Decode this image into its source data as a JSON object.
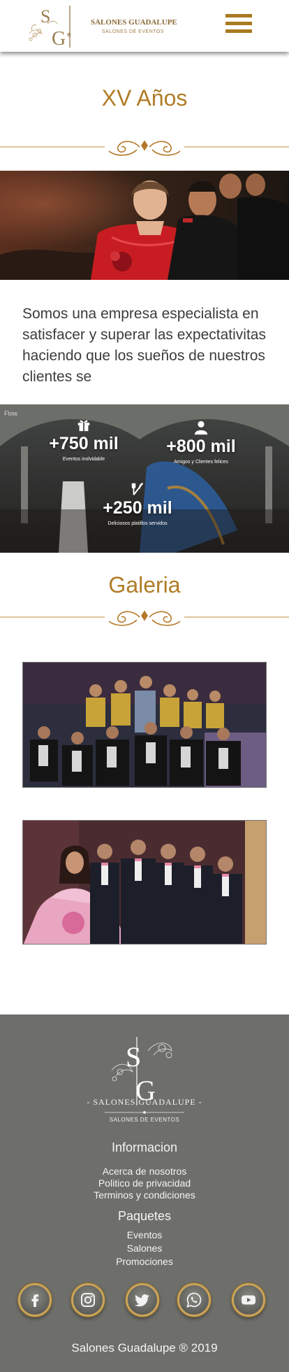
{
  "header": {
    "brand_name": "SALONES GUADALUPE",
    "brand_sub": "SALONES DE EVENTOS",
    "menu_icon": "hamburger-menu-icon"
  },
  "page": {
    "title": "XV Años",
    "intro": "Somos una empresa especialista en satisfacer y superar las expectativitas haciendo que los sueños de nuestros clientes se"
  },
  "stats": [
    {
      "icon": "gift-icon",
      "value": "+750 mil",
      "label": "Eventos inolvidable"
    },
    {
      "icon": "person-icon",
      "value": "+800 mil",
      "label": "Amigos y Clientes felices"
    },
    {
      "icon": "cutlery-icon",
      "value": "+250 mil",
      "label": "Deliciosos platillos servidos"
    }
  ],
  "gallery": {
    "title": "Galeria"
  },
  "footer": {
    "brand_name": "- SALONES GUADALUPE -",
    "brand_sub": "SALONES DE EVENTOS",
    "info_heading": "Informacion",
    "info_links": [
      "Acerca de nosotros",
      "Politico de privacidad",
      "Terminos y condiciones"
    ],
    "packages_heading": "Paquetes",
    "package_links": [
      "Eventos",
      "Salones",
      "Promociones"
    ],
    "social": [
      "facebook-icon",
      "instagram-icon",
      "twitter-icon",
      "whatsapp-icon",
      "youtube-icon"
    ],
    "copyright": "Salones Guadalupe ® 2019"
  },
  "colors": {
    "gold": "#b07c28",
    "footer_bg": "#6e6e6a",
    "menu": "#a97a1e"
  }
}
